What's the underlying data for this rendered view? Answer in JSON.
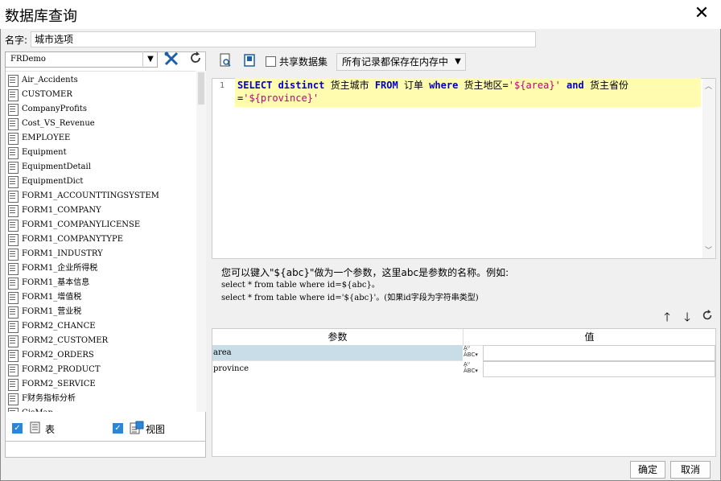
{
  "window": {
    "title": "数据库查询",
    "close_glyph": "✕"
  },
  "name_field": {
    "label": "名字:",
    "value": "城市选项"
  },
  "datasource": {
    "selected": "FRDemo"
  },
  "tables": [
    "Air_Accidents",
    "CUSTOMER",
    "CompanyProfits",
    "Cost_VS_Revenue",
    "EMPLOYEE",
    "Equipment",
    "EquipmentDetail",
    "EquipmentDict",
    "FORM1_ACCOUNTTINGSYSTEM",
    "FORM1_COMPANY",
    "FORM1_COMPANYLICENSE",
    "FORM1_COMPANYTYPE",
    "FORM1_INDUSTRY",
    "FORM1_企业所得税",
    "FORM1_基本信息",
    "FORM1_增值税",
    "FORM1_营业税",
    "FORM2_CHANCE",
    "FORM2_CUSTOMER",
    "FORM2_ORDERS",
    "FORM2_PRODUCT",
    "FORM2_SERVICE",
    "F财务指标分析",
    "GisMap"
  ],
  "filters": {
    "table_label": "表",
    "view_label": "视图"
  },
  "toolbar": {
    "share_label": "共享数据集",
    "storage_mode": "所有记录都保存在内存中"
  },
  "editor": {
    "line_number": "1",
    "sql_parts": [
      {
        "t": "kw",
        "v": "SELECT distinct"
      },
      {
        "t": "tx",
        "v": " 货主城市 "
      },
      {
        "t": "kw",
        "v": "FROM"
      },
      {
        "t": "tx",
        "v": " 订单 "
      },
      {
        "t": "kw",
        "v": "where"
      },
      {
        "t": "tx",
        "v": " 货主地区="
      },
      {
        "t": "str",
        "v": "'${area}'"
      },
      {
        "t": "tx",
        "v": " "
      },
      {
        "t": "kw",
        "v": "and"
      },
      {
        "t": "tx",
        "v": " 货主省份="
      },
      {
        "t": "str",
        "v": "'${province}'"
      }
    ]
  },
  "hint": {
    "line1": "您可以键入\"${abc}\"做为一个参数，这里abc是参数的名称。例如:",
    "line2": "select * from table where id=${abc}。",
    "line3": "select * from table where id='${abc}'。(如果id字段为字符串类型)"
  },
  "params": {
    "headers": {
      "name": "参数",
      "value": "值"
    },
    "rows": [
      {
        "name": "area",
        "value": ""
      },
      {
        "name": "province",
        "value": ""
      }
    ]
  },
  "buttons": {
    "ok": "确定",
    "cancel": "取消"
  }
}
